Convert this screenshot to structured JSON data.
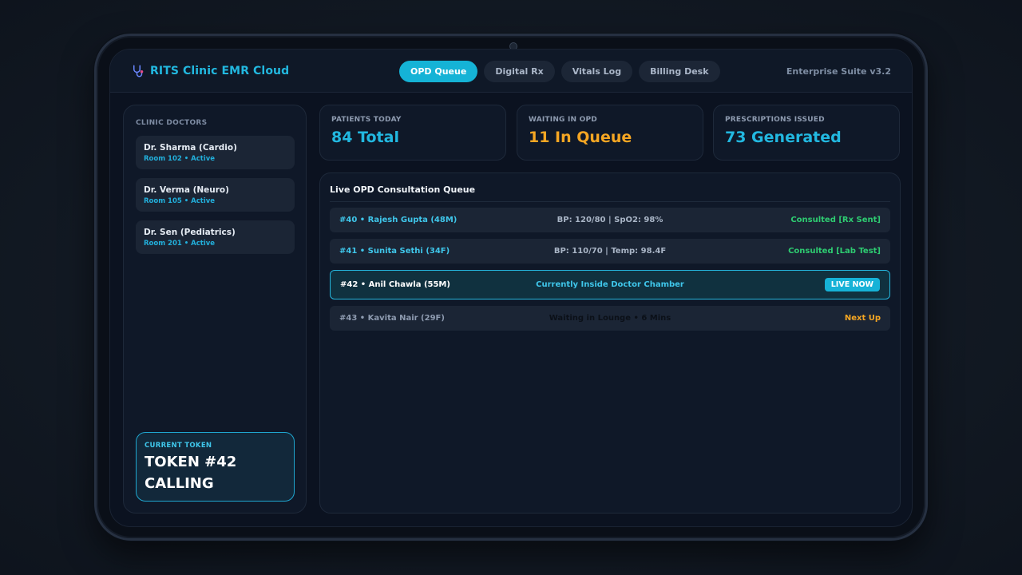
{
  "app": {
    "title": "RITS Clinic EMR Cloud",
    "suite": "Enterprise Suite v3.2"
  },
  "tabs": [
    {
      "label": "OPD Queue",
      "active": true
    },
    {
      "label": "Digital Rx",
      "active": false
    },
    {
      "label": "Vitals Log",
      "active": false
    },
    {
      "label": "Billing Desk",
      "active": false
    }
  ],
  "sidebar": {
    "title": "CLINIC DOCTORS",
    "doctors": [
      {
        "name": "Dr. Sharma (Cardio)",
        "sub": "Room 102 • Active"
      },
      {
        "name": "Dr. Verma (Neuro)",
        "sub": "Room 105 • Active"
      },
      {
        "name": "Dr. Sen (Pediatrics)",
        "sub": "Room 201 • Active"
      }
    ],
    "token": {
      "label": "CURRENT TOKEN",
      "line1": "TOKEN #42",
      "line2": "CALLING"
    }
  },
  "stats": [
    {
      "label": "PATIENTS TODAY",
      "value": "84 Total",
      "color": "#22b8e0"
    },
    {
      "label": "WAITING IN OPD",
      "value": "11 In Queue",
      "color": "#f5a623"
    },
    {
      "label": "PRESCRIPTIONS ISSUED",
      "value": "73 Generated",
      "color": "#22b8e0"
    }
  ],
  "queue": {
    "title": "Live OPD Consultation Queue",
    "rows": [
      {
        "patient": "#40 • Rajesh Gupta (48M)",
        "info": "BP: 120/80 | SpO2: 98%",
        "status": "Consulted [Rx Sent]"
      },
      {
        "patient": "#41 • Sunita Sethi (34F)",
        "info": "BP: 110/70 | Temp: 98.4F",
        "status": "Consulted [Lab Test]"
      },
      {
        "patient": "#42 • Anil Chawla (55M)",
        "info": "Currently Inside Doctor Chamber",
        "status": "LIVE NOW"
      },
      {
        "patient": "#43 • Kavita Nair (29F)",
        "info": "Waiting in Lounge • 6 Mins",
        "status": "Next Up"
      }
    ]
  },
  "colors": {
    "accent": "#15b3d6",
    "success": "#2ecc71",
    "warning": "#f5a623",
    "background": "#0b1220"
  },
  "icons": {
    "brand": "stethoscope-icon"
  }
}
